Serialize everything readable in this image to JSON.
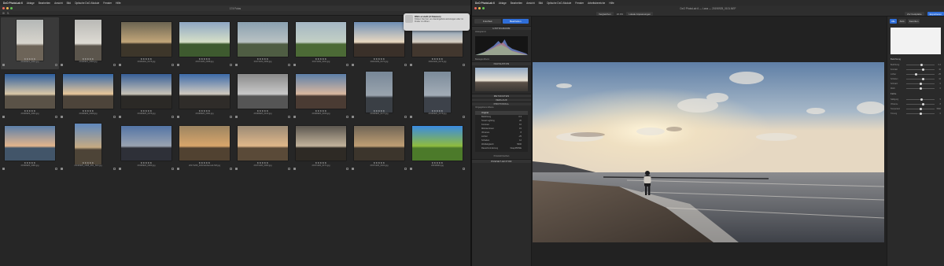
{
  "menubar_left": {
    "app_name": "DxO PhotoLab 6",
    "items": [
      "Ablage",
      "Bearbeiten",
      "Ansicht",
      "Bild",
      "Optische DxO-Module",
      "Fenster",
      "Hilfe"
    ]
  },
  "menubar_right": {
    "app_name": "DxO PhotoLab 6",
    "items": [
      "Ablage",
      "Bearbeiten",
      "Ansicht",
      "Bild",
      "Optische DxO-Module",
      "Fenster",
      "Arbeitsbereiche",
      "Hilfe"
    ]
  },
  "browser": {
    "window_title": "174 Fotos",
    "notification": {
      "title": "DNG erstellt (3 Dateien)",
      "body": "Klicken Sie hier, um das Ergebnis anzuzeigen oder im Finder zu öffnen."
    },
    "thumbnails": [
      {
        "stars": "★★★★★",
        "name": "20190921_0001.jpg",
        "colors": [
          "#b4b7b6",
          "#d8d5cd",
          "#6d6458"
        ],
        "portrait": true,
        "selected": true
      },
      {
        "stars": "★★★★★",
        "name": "20190921_0002.jpg",
        "colors": [
          "#b9b9b6",
          "#dedbd3",
          "#5b554c"
        ],
        "portrait": true
      },
      {
        "stars": "★★★★★",
        "name": "20181011_0176.jpg",
        "colors": [
          "#6c6552",
          "#c2a679",
          "#3d362a"
        ]
      },
      {
        "stars": "★★★★★",
        "name": "20171205_0008.jpg",
        "colors": [
          "#8ea6c3",
          "#d6e0c8",
          "#3e5a2f"
        ]
      },
      {
        "stars": "★★★★★",
        "name": "20171103_0009.jpg",
        "colors": [
          "#8aa0b0",
          "#b9c2c3",
          "#4f5d43"
        ]
      },
      {
        "stars": "★★★★★",
        "name": "20171109_0191.jpg",
        "colors": [
          "#a4b6c4",
          "#c3d0c5",
          "#4c6a36"
        ]
      },
      {
        "stars": "★★★★★",
        "name": "20221109_0172.jpg",
        "colors": [
          "#6f8fb5",
          "#e9d9c1",
          "#3a3029"
        ]
      },
      {
        "stars": "★★★★★",
        "name": "20221102_0173.jpg",
        "colors": [
          "#6389b4",
          "#d7cfc2",
          "#42372e"
        ]
      },
      {
        "stars": "★★★★★",
        "name": "20190929_0001.jpg",
        "colors": [
          "#2c5d9c",
          "#d9c7a7",
          "#5a5247"
        ]
      },
      {
        "stars": "★★★★★",
        "name": "20190929_0009.jpg",
        "colors": [
          "#3567a6",
          "#e8c79a",
          "#4d443a"
        ]
      },
      {
        "stars": "★★★★★",
        "name": "20190925_0076.jpg",
        "colors": [
          "#365e97",
          "#c8c3b7",
          "#2b2926"
        ]
      },
      {
        "stars": "★★★★★",
        "name": "20190926_0091.jpg",
        "colors": [
          "#3c6aa8",
          "#d0cac0",
          "#2f2c29"
        ]
      },
      {
        "stars": "★★★★★",
        "name": "20190926_0122.jpg",
        "colors": [
          "#8a8a8a",
          "#c9c9c9",
          "#555555"
        ]
      },
      {
        "stars": "★★★★★",
        "name": "20190926_0166.jpg",
        "colors": [
          "#5c7fa8",
          "#d9b8a0",
          "#4a3b33"
        ]
      },
      {
        "stars": "★★★★★",
        "name": "20190926_0177.jpg",
        "colors": [
          "#778797",
          "#9aa4ae",
          "#3a3f45"
        ],
        "portrait": true
      },
      {
        "stars": "★★★★★",
        "name": "20190926_0179.jpg",
        "colors": [
          "#7b8a99",
          "#a3adb7",
          "#3d424a"
        ],
        "portrait": true
      },
      {
        "stars": "★★★★★",
        "name": "20190925_0081.jpg",
        "colors": [
          "#5b7fa9",
          "#e3b58c",
          "#425569"
        ]
      },
      {
        "stars": "★★★★★",
        "name": "20190925_0098_R01_S03.jpg",
        "colors": [
          "#5f88bd",
          "#c6ab83",
          "#4d4437"
        ],
        "portrait": true
      },
      {
        "stars": "★★★★★",
        "name": "20190922_0003.jpg",
        "colors": [
          "#5374a5",
          "#9aa3b1",
          "#2e3038"
        ]
      },
      {
        "stars": "★★★★★",
        "name": "20171206_0210-Enhanced-NR.jpg",
        "colors": [
          "#9c8461",
          "#d9a66b",
          "#514231"
        ]
      },
      {
        "stars": "★★★★★",
        "name": "20171206_0003.jpg",
        "colors": [
          "#9b8a75",
          "#e0b88a",
          "#5a4a38"
        ]
      },
      {
        "stars": "★★★★★",
        "name": "20171206_0171.jpg",
        "colors": [
          "#5c5750",
          "#c2b39b",
          "#2e2a25"
        ]
      },
      {
        "stars": "★★★★★",
        "name": "20171206_0101.jpg",
        "colors": [
          "#6f6455",
          "#c09f74",
          "#3c352c"
        ]
      },
      {
        "stars": "★★★★★",
        "name": "20190926.jpg",
        "colors": [
          "#3b8be0",
          "#8fbc3e",
          "#4c7a2a"
        ]
      }
    ]
  },
  "editor": {
    "window_title": "DxO PhotoLab 6 — Lana — 20190925_0101.NEF",
    "tools": {
      "compare": "Vergleichen",
      "zoom": "20.0%",
      "local_adjust": "Lokale Anpassungen",
      "export": "Exportieren",
      "export_disk": "Zur Festplatte"
    },
    "modes": [
      "Fotothek",
      "Bearbeiten"
    ],
    "left_sections": {
      "histogram": "HISTOGRAMM",
      "histogram_label": "Histogramm",
      "moving_label": "Bewegen/Zoom",
      "nav": "NAVIGATION",
      "preset_label": "Vorgegebene Ebene",
      "metadata": "METADATEN",
      "history": "VERLAUF",
      "protocol": "PROTOKOLL",
      "preset_editor": "PRESET-EDITOR"
    },
    "history_items": [
      {
        "label": "Original",
        "value": ""
      },
      {
        "label": "Belichtung",
        "value": "0.3"
      },
      {
        "label": "Smart Lighting",
        "value": "20"
      },
      {
        "label": "Kontrast",
        "value": "10"
      },
      {
        "label": "Mikrokontrast",
        "value": "15"
      },
      {
        "label": "Vibrance",
        "value": "8"
      },
      {
        "label": "Lichter",
        "value": "-25"
      },
      {
        "label": "Schatten",
        "value": "12"
      },
      {
        "label": "Weißabgleich",
        "value": "5600"
      },
      {
        "label": "Rauschminderung",
        "value": "DeepPRIME"
      }
    ],
    "history_footer": "Protokoll löschen",
    "right_panel": {
      "buttons": [
        "Alle",
        "Aktiv",
        "Favoriten"
      ],
      "section1": "Belichtung",
      "section2": "Farbe",
      "sliders": [
        {
          "label": "Belichtung",
          "value": "0.3",
          "pos": 0.55
        },
        {
          "label": "Kontrast",
          "value": "10",
          "pos": 0.6
        },
        {
          "label": "Lichter",
          "value": "-25",
          "pos": 0.35
        },
        {
          "label": "Schatten",
          "value": "12",
          "pos": 0.6
        },
        {
          "label": "Schwarz",
          "value": "0",
          "pos": 0.5
        },
        {
          "label": "Weiß",
          "value": "0",
          "pos": 0.5
        },
        {
          "label": "Sättigung",
          "value": "5",
          "pos": 0.55
        },
        {
          "label": "Vibrance",
          "value": "8",
          "pos": 0.6
        },
        {
          "label": "Temperatur",
          "value": "5600",
          "pos": 0.5
        },
        {
          "label": "Tönung",
          "value": "0",
          "pos": 0.5
        }
      ]
    }
  }
}
